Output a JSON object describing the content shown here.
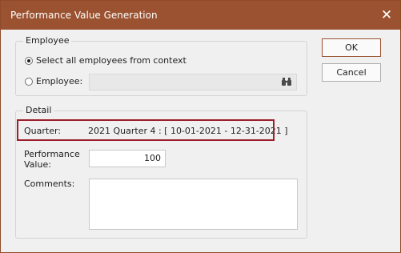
{
  "window": {
    "title": "Performance Value Generation"
  },
  "employee_group": {
    "legend": "Employee",
    "select_all_label": "Select all employees from context",
    "employee_label": "Employee:",
    "employee_value": "",
    "selected_option": "select_all"
  },
  "detail_group": {
    "legend": "Detail",
    "quarter_label": "Quarter:",
    "quarter_value": "2021 Quarter 4 : [ 10-01-2021 - 12-31-2021 ]",
    "performance_label_line1": "Performance",
    "performance_label_line2": "Value:",
    "performance_value": "100",
    "comments_label": "Comments:",
    "comments_value": ""
  },
  "buttons": {
    "ok": "OK",
    "cancel": "Cancel"
  },
  "colors": {
    "titlebar": "#9a5230",
    "highlight_border": "#9c1f2c",
    "default_button_border": "#9a5230"
  }
}
